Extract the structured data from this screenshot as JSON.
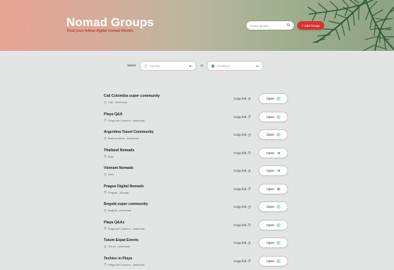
{
  "header": {
    "title": "Nomad Groups",
    "subtitle": "Find your fellow digital nomad friends",
    "search_placeholder": "Search groups...",
    "add_button": "+ Add Group",
    "accent_color": "#d83232"
  },
  "filters": {
    "select_label": "Select",
    "or_label": "or",
    "country_placeholder": "Country",
    "continent_placeholder": "Continent"
  },
  "groups": [
    {
      "name": "Cali Colombia super community",
      "location": "Cali - Americas",
      "copy_label": "Copy link",
      "open_label": "Open",
      "app_icon": "whatsapp-icon"
    },
    {
      "name": "Playa Q&A",
      "location": "Playa del Carmen - Americas",
      "copy_label": "Copy link",
      "open_label": "Open",
      "app_icon": "whatsapp-icon"
    },
    {
      "name": "Argentina Travel Community",
      "location": "Buenos Aires - Americas",
      "copy_label": "Copy link",
      "open_label": "Open",
      "app_icon": "whatsapp-icon"
    },
    {
      "name": "Thailand Nomads",
      "location": "Asia",
      "copy_label": "Copy link",
      "open_label": "Open",
      "app_icon": "telegram-icon"
    },
    {
      "name": "Vietnam Nomads",
      "location": "Asia",
      "copy_label": "Copy link",
      "open_label": "Open",
      "app_icon": "telegram-icon"
    },
    {
      "name": "Prague Digital Nomads",
      "location": "Prague - Europe",
      "copy_label": "Copy link",
      "open_label": "Open",
      "app_icon": "signal-icon"
    },
    {
      "name": "Bogotá super community",
      "location": "Bogotá - Americas",
      "copy_label": "Copy link",
      "open_label": "Open",
      "app_icon": "whatsapp-icon"
    },
    {
      "name": "Playa Q&As",
      "location": "Playa del Carmen - Americas",
      "copy_label": "Copy link",
      "open_label": "Open",
      "app_icon": "whatsapp-icon"
    },
    {
      "name": "Tulum Expat Events",
      "location": "Tulum - Americas",
      "copy_label": "Copy link",
      "open_label": "Open",
      "app_icon": "whatsapp-icon"
    },
    {
      "name": "Techies in Playa",
      "location": "Playa del Carmen - Americas",
      "copy_label": "Copy link",
      "open_label": "Open",
      "app_icon": "whatsapp-icon"
    }
  ]
}
